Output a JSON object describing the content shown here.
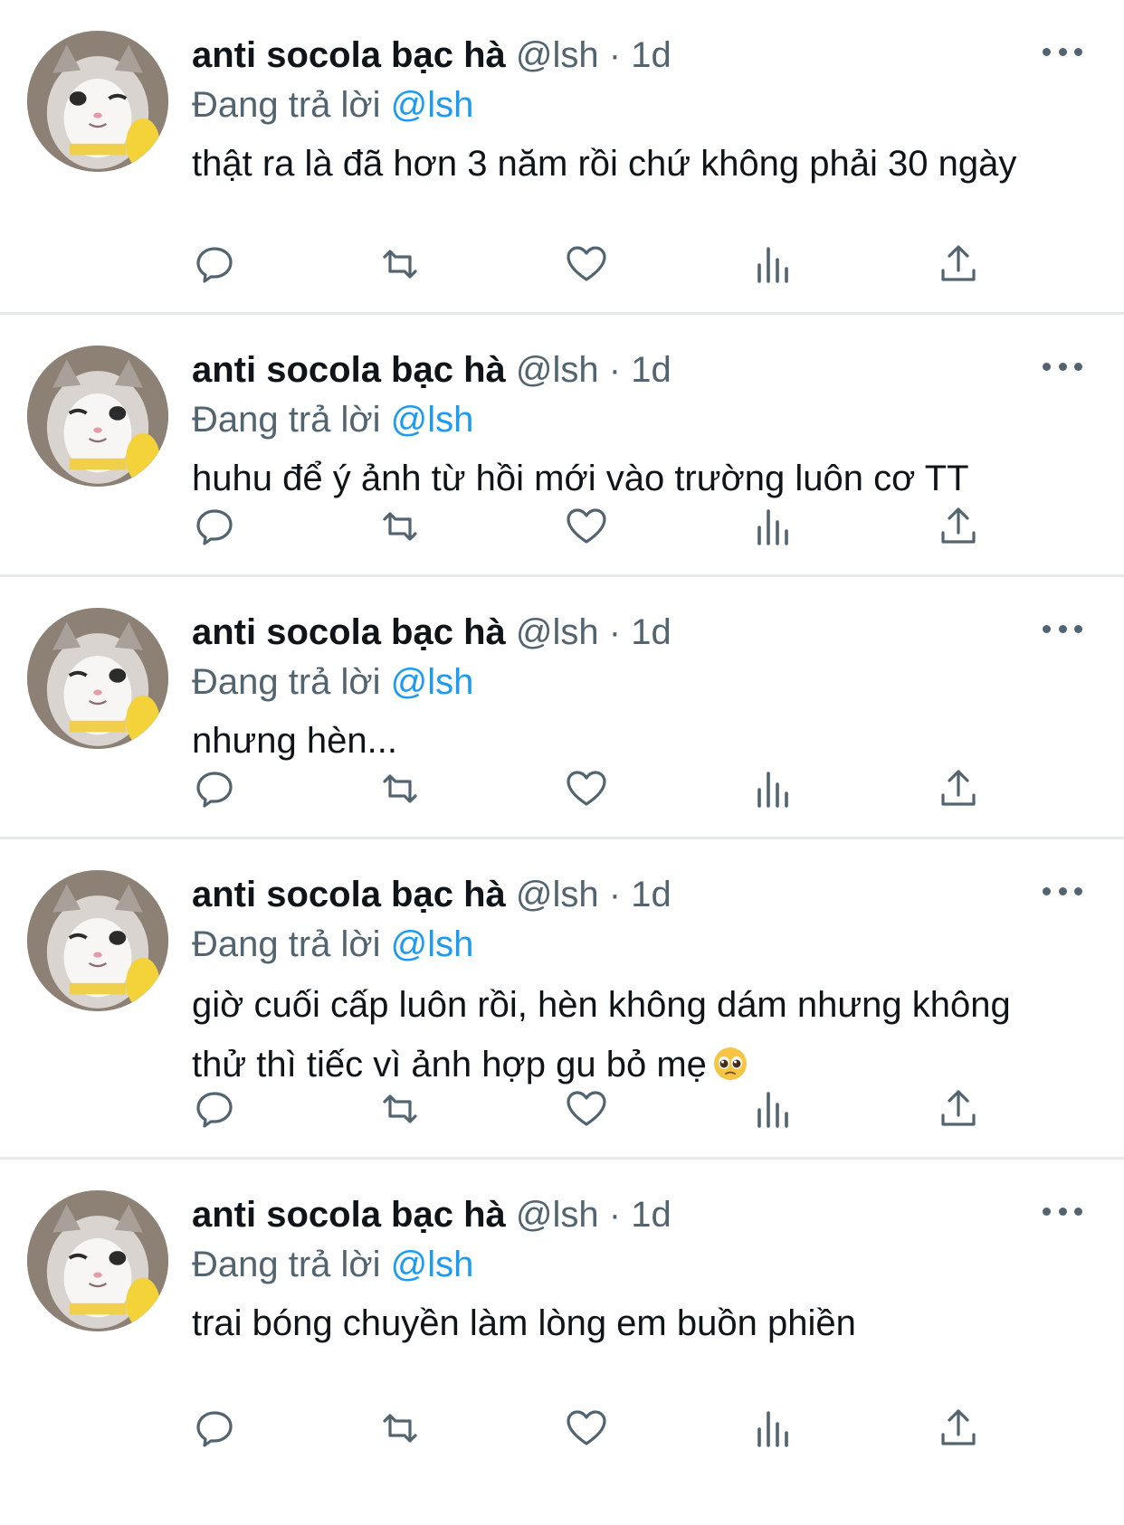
{
  "colors": {
    "text": "#0f1419",
    "muted": "#536471",
    "link": "#1d9bf0",
    "divider": "#e6e9ec"
  },
  "tweets": [
    {
      "name": "anti socola bạc hà",
      "handle": "@lsh",
      "dot": "·",
      "time": "1d",
      "reply_prefix": "Đang trả lời",
      "reply_to": "@lsh",
      "text": "thật ra là đã hơn 3 năm rồi chứ không phải 30 ngày"
    },
    {
      "name": "anti socola bạc hà",
      "handle": "@lsh",
      "dot": "·",
      "time": "1d",
      "reply_prefix": "Đang trả lời",
      "reply_to": "@lsh",
      "text": "huhu để ý ảnh từ hồi mới vào trường luôn cơ TT"
    },
    {
      "name": "anti socola bạc hà",
      "handle": "@lsh",
      "dot": "·",
      "time": "1d",
      "reply_prefix": "Đang trả lời",
      "reply_to": "@lsh",
      "text": "nhưng hèn..."
    },
    {
      "name": "anti socola bạc hà",
      "handle": "@lsh",
      "dot": "·",
      "time": "1d",
      "reply_prefix": "Đang trả lời",
      "reply_to": "@lsh",
      "text": "giờ cuối cấp luôn rồi, hèn không dám nhưng không thử thì tiếc vì ảnh hợp gu bỏ mẹ",
      "emoji": "pleading-face-emoji"
    },
    {
      "name": "anti socola bạc hà",
      "handle": "@lsh",
      "dot": "·",
      "time": "1d",
      "reply_prefix": "Đang trả lời",
      "reply_to": "@lsh",
      "text": "trai bóng chuyền làm lòng em buồn phiền"
    }
  ],
  "icons": {
    "avatar": "cat-avatar",
    "more": "more-options-icon",
    "reply": "reply-icon",
    "retweet": "retweet-icon",
    "like": "heart-icon",
    "views": "views-chart-icon",
    "share": "share-icon"
  }
}
